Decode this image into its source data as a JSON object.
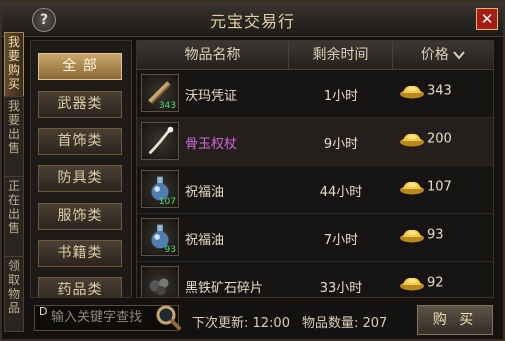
{
  "window": {
    "title": "元宝交易行",
    "help": "?",
    "close": "✕"
  },
  "side_tabs": [
    "我要购买",
    "我要出售",
    "正在出售",
    "领取物品"
  ],
  "categories": [
    "全 部",
    "武器类",
    "首饰类",
    "防具类",
    "服饰类",
    "书籍类",
    "药品类"
  ],
  "active_category": 0,
  "table": {
    "headers": [
      "物品名称",
      "剩余时间",
      "价格"
    ],
    "sort_arrow": "chevron-down-icon",
    "rows": [
      {
        "name": "沃玛凭证",
        "qty": "343",
        "time": "1小时",
        "price": "343",
        "name_color": "#e6dcc6",
        "icon": "scroll-icon"
      },
      {
        "name": "骨玉权杖",
        "qty": "",
        "time": "9小时",
        "price": "200",
        "name_color": "#d06ad8",
        "icon": "staff-icon"
      },
      {
        "name": "祝福油",
        "qty": "107",
        "time": "44小时",
        "price": "107",
        "name_color": "#e6dcc6",
        "icon": "potion-icon"
      },
      {
        "name": "祝福油",
        "qty": "93",
        "time": "7小时",
        "price": "93",
        "name_color": "#e6dcc6",
        "icon": "potion-icon"
      },
      {
        "name": "黑铁矿石碎片",
        "qty": "",
        "time": "33小时",
        "price": "92",
        "name_color": "#e6dcc6",
        "icon": "ore-icon"
      }
    ]
  },
  "search": {
    "placeholder": "输入关键字查找",
    "prefix": "D"
  },
  "status": {
    "next_update": "下次更新: 12:00",
    "item_count": "物品数量: 207"
  },
  "buy_button": "购 买",
  "colors": {
    "gold": "#e1c489",
    "accent_red": "#a51d14"
  }
}
